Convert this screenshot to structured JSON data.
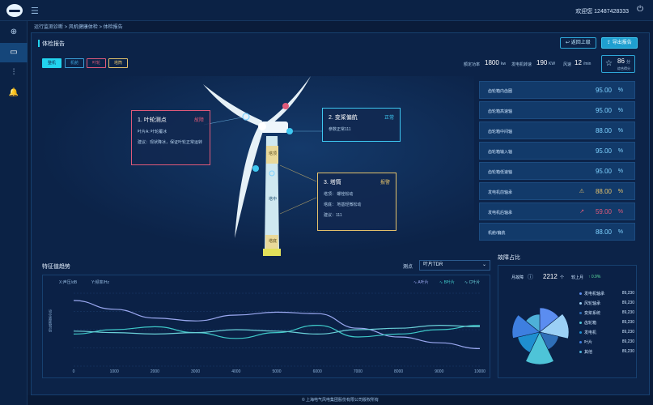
{
  "header": {
    "welcome": "欢迎您 12487428333"
  },
  "breadcrumb": "运行监测诊断 > 风机健康体检 > 体检报告",
  "page": {
    "title": "体检报告",
    "back_label": "返回上级",
    "export_label": "导出报告"
  },
  "chips": [
    {
      "label": "整机",
      "color": "#22d3ee"
    },
    {
      "label": "机舱",
      "color": "#3aa0d8"
    },
    {
      "label": "叶轮",
      "color": "#e05a7a"
    },
    {
      "label": "塔筒",
      "color": "#e3c16b"
    }
  ],
  "stats": {
    "rated_label": "额定功率",
    "rated_val": "1800",
    "rated_unit": "kw",
    "gen_label": "发电机转速",
    "gen_val": "190",
    "gen_unit": "KW",
    "wind_label": "风速",
    "wind_val": "12",
    "wind_unit": "/min"
  },
  "score": {
    "value": "86",
    "unit": "分",
    "label": "综合得分"
  },
  "callouts": {
    "c1": {
      "title": "1.  叶轮测点",
      "tag": "故障",
      "line1": "叶片A:   叶轮覆冰",
      "line2": "建议：现状降冰，保证叶轮正常运转"
    },
    "c2": {
      "title": "2.  变桨偏航",
      "tag": "正常",
      "line1": "参数正常111"
    },
    "c3": {
      "title": "3.  塔筒",
      "tag": "报警",
      "line1": "塔顶：       螺栓松动",
      "line2": "塔底：       地基轻微松动",
      "line3": "建议：111"
    }
  },
  "tower_labels": [
    "塔顶",
    "塔中",
    "塔底"
  ],
  "components": [
    {
      "name": "齿轮箱内齿圈",
      "value": "95.00",
      "unit": "%",
      "icon": "",
      "color": "#7fd2ff"
    },
    {
      "name": "齿轮箱高速轴",
      "value": "95.00",
      "unit": "%",
      "icon": "",
      "color": "#7fd2ff"
    },
    {
      "name": "齿轮箱中间轴",
      "value": "88.00",
      "unit": "%",
      "icon": "",
      "color": "#7fd2ff"
    },
    {
      "name": "齿轮箱输入轴",
      "value": "95.00",
      "unit": "%",
      "icon": "",
      "color": "#7fd2ff"
    },
    {
      "name": "齿轮箱低速轴",
      "value": "95.00",
      "unit": "%",
      "icon": "",
      "color": "#7fd2ff"
    },
    {
      "name": "发电机前轴承",
      "value": "88.00",
      "unit": "%",
      "icon": "⚠",
      "color": "#e3c16b"
    },
    {
      "name": "发电机后轴承",
      "value": "59.00",
      "unit": "%",
      "icon": "↗",
      "color": "#e05a7a"
    },
    {
      "name": "机舱/偏航",
      "value": "88.00",
      "unit": "%",
      "icon": "",
      "color": "#7fd2ff"
    }
  ],
  "trend": {
    "title": "特征值趋势",
    "point_label": "测点",
    "point_value": "叶片TDR",
    "xaxis_label": "X:声压/dB",
    "yaxis_label": "Y:频率/Hz",
    "ylabel": "特征值趋势分析",
    "legend": [
      "A叶片",
      "B叶片",
      "C叶片"
    ]
  },
  "chart_data": {
    "type": "line",
    "x": [
      0,
      1000,
      2000,
      3000,
      4000,
      5000,
      6000,
      7000,
      8000,
      9000,
      10000
    ],
    "series": [
      {
        "name": "A叶片",
        "values": [
          90,
          78,
          66,
          62,
          70,
          74,
          72,
          52,
          40,
          32,
          24
        ],
        "color": "#9aa8f0"
      },
      {
        "name": "B叶片",
        "values": [
          44,
          50,
          54,
          46,
          38,
          46,
          56,
          40,
          44,
          50,
          56
        ],
        "color": "#3ec8c8"
      },
      {
        "name": "C叶片",
        "values": [
          48,
          46,
          44,
          46,
          50,
          48,
          44,
          50,
          52,
          56,
          54
        ],
        "color": "#6ad0d8"
      }
    ],
    "xlim": [
      0,
      10000
    ],
    "ylim": [
      0,
      100
    ]
  },
  "fault": {
    "title": "故障占比",
    "total_label": "月故障",
    "total_val": "2212",
    "total_unit": "个",
    "mom_label": "较上月",
    "mom_val": "↑ 0.9%"
  },
  "fault_pie": {
    "type": "pie",
    "slices": [
      {
        "name": "发电机轴承",
        "value": 89230,
        "display": "89,230",
        "color": "#5b8df0"
      },
      {
        "name": "风轮轴承",
        "value": 89230,
        "display": "89,230",
        "color": "#9bd0f5"
      },
      {
        "name": "变桨系统",
        "value": 89230,
        "display": "89,230",
        "color": "#2f6fb8"
      },
      {
        "name": "齿轮箱",
        "value": 89230,
        "display": "89,230",
        "color": "#4ec4d8"
      },
      {
        "name": "发电机",
        "value": 89230,
        "display": "89,230",
        "color": "#1f8fd0"
      },
      {
        "name": "叶片",
        "value": 89230,
        "display": "89,230",
        "color": "#3e7fe0"
      },
      {
        "name": "其他",
        "value": 89230,
        "display": "89,230",
        "color": "#4eb0d8"
      }
    ],
    "labels": [
      "发电机轴承",
      "风轮轴承",
      "变桨系统",
      "齿轮箱",
      "发电机",
      "叶片",
      "其他"
    ]
  },
  "footer": "© 上海电气风电集团股份有限公司版权所有"
}
